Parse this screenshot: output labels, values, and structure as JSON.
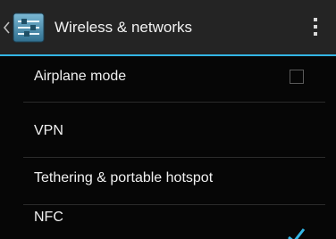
{
  "action_bar": {
    "title": "Wireless & networks",
    "up_icon": "chevron-left-icon",
    "app_icon": "settings-sliders-icon",
    "overflow_icon": "overflow-menu-icon"
  },
  "preferences": [
    {
      "label": "Airplane mode",
      "control": "checkbox",
      "checked": false
    },
    {
      "label": "VPN"
    },
    {
      "label": "Tethering & portable hotspot"
    },
    {
      "label": "NFC",
      "control": "checkbox",
      "checked": true
    }
  ],
  "colors": {
    "accent": "#33b5e5",
    "action_bar": "#242424",
    "background": "#060606",
    "text": "#f0f0f0",
    "divider": "#2b2b2b"
  }
}
